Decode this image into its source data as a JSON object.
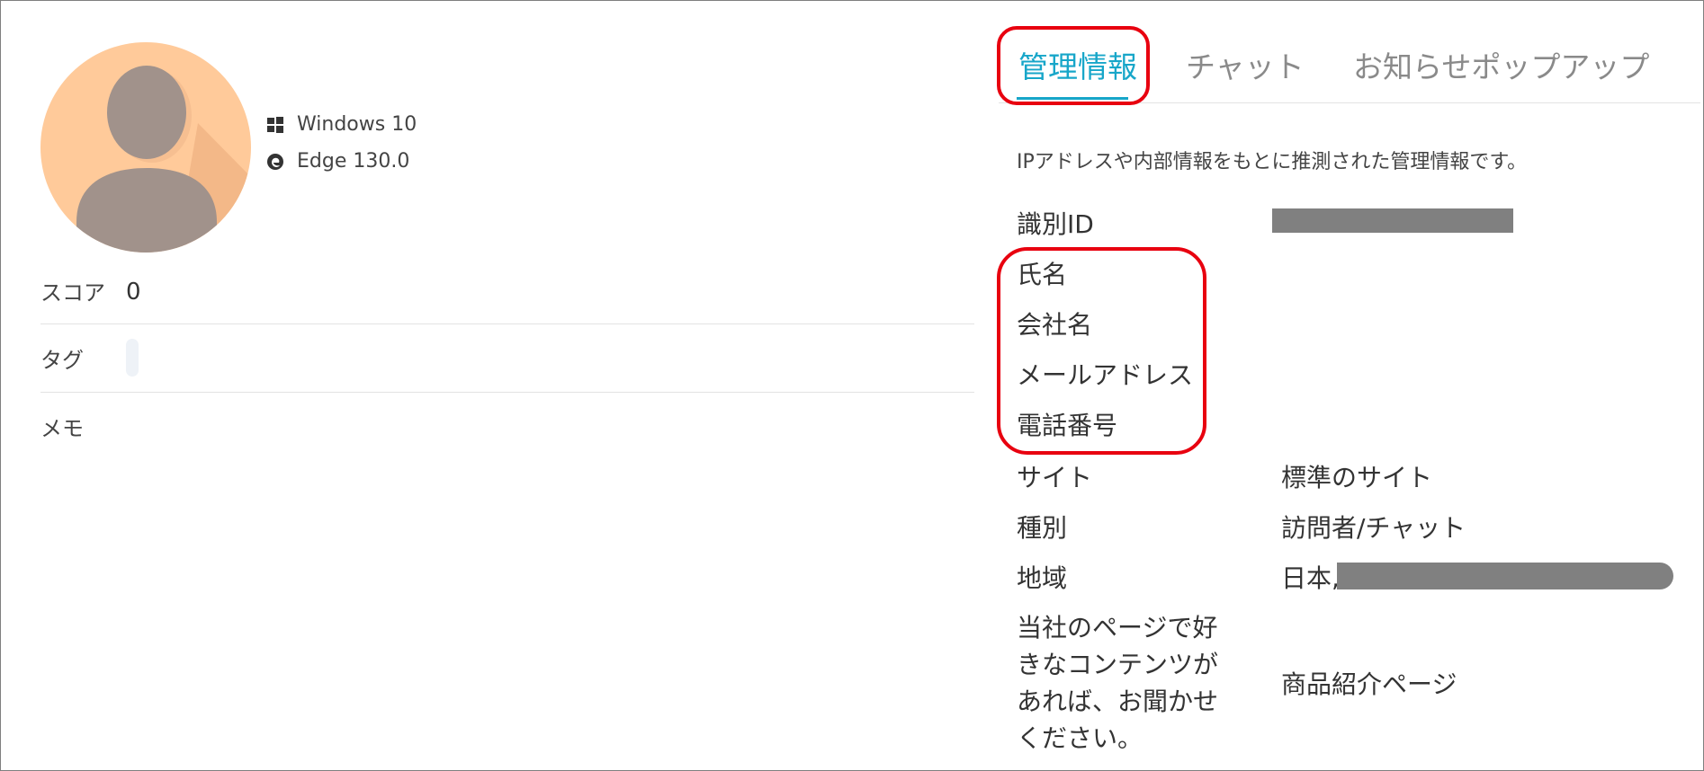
{
  "visitor": {
    "os": "Windows 10",
    "browser": "Edge 130.0",
    "os_icon": "windows-icon",
    "browser_icon": "edge-icon"
  },
  "left_fields": {
    "score_label": "スコア",
    "score_value": "0",
    "tags_label": "タグ",
    "memo_label": "メモ"
  },
  "tabs": [
    {
      "label": "管理情報",
      "active": true
    },
    {
      "label": "チャット",
      "active": false
    },
    {
      "label": "お知らせポップアップ",
      "active": false
    }
  ],
  "management": {
    "description": "IPアドレスや内部情報をもとに推測された管理情報です。",
    "rows": [
      {
        "label": "識別ID",
        "value": ""
      },
      {
        "label": "氏名",
        "value": ""
      },
      {
        "label": "会社名",
        "value": ""
      },
      {
        "label": "メールアドレス",
        "value": ""
      },
      {
        "label": "電話番号",
        "value": ""
      },
      {
        "label": "サイト",
        "value": "標準のサイト"
      },
      {
        "label": "種別",
        "value": "訪問者/チャット"
      },
      {
        "label": "地域",
        "value": "日本,"
      },
      {
        "label": "当社のページで好きなコンテンツがあれば、お聞かせください。",
        "value": "商品紹介ページ"
      }
    ]
  },
  "colors": {
    "accent": "#17a6c9",
    "highlight": "#e8000f",
    "avatar_bg": "#ffca9a",
    "redaction": "#808080"
  }
}
